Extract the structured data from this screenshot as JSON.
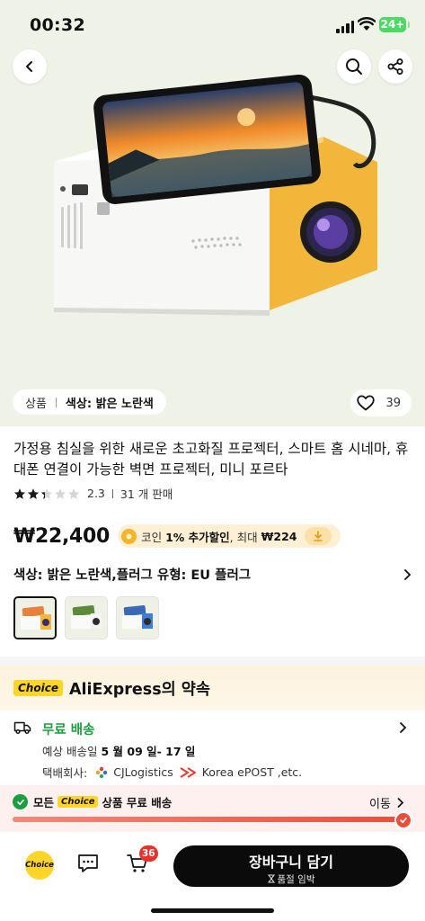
{
  "status_bar": {
    "time": "00:32",
    "battery": "24+"
  },
  "hero": {
    "variant_pill": {
      "label": "상품",
      "value": "색상: 밝은 노란색"
    },
    "likes": "39"
  },
  "product": {
    "title": "가정용 침실을 위한 새로운 초고화질 프로젝터, 스마트 홈 시네마, 휴대폰 연결이 가능한 벽면 프로젝터, 미니 포르타",
    "rating": "2.3",
    "sold": "31 개 판매",
    "price": "₩22,400",
    "coin_promo": {
      "prefix": "코인",
      "bold": "1% 추가할인",
      "suffix": ", 최대",
      "max": "₩224"
    },
    "selected_option": "색상: 밝은 노란색,플러그 유형: EU 플러그"
  },
  "promise": {
    "choice_tag": "Choice",
    "title": "AliExpress의 약속"
  },
  "shipping": {
    "title": "무료 배송",
    "date_label": "예상 배송일",
    "date_value": "5 월 09 일- 17 일",
    "carrier_label": "택배회사:",
    "carrier_1": "CJLogistics",
    "carrier_2": "Korea ePOST ,etc."
  },
  "free_banner": {
    "prefix": "모든",
    "choice_tag": "Choice",
    "suffix": "상품 무료 배송",
    "action": "이동",
    "progress": 1.0
  },
  "bottom_bar": {
    "choice_label": "Choice",
    "cart_count": "36",
    "cta_label": "장바구니 담기",
    "cta_sub": "품절 임박"
  },
  "colors": {
    "accent_green": "#1a9e3f",
    "badge_red": "#e8322b",
    "choice_yellow": "#ffd52a",
    "progress_red": "#ec4d3a",
    "cta_black": "#0b0b0b"
  }
}
